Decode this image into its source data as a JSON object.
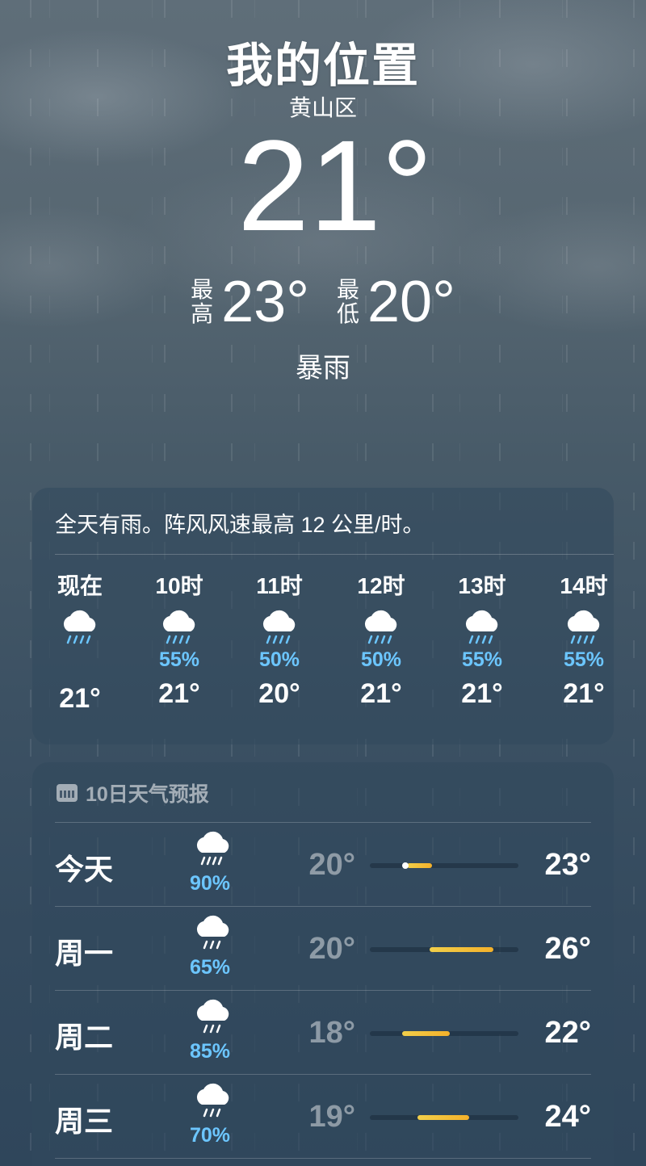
{
  "location": {
    "title": "我的位置",
    "district": "黄山区"
  },
  "current": {
    "temp": "21°",
    "high_label": [
      "最",
      "高"
    ],
    "high": "23°",
    "low_label": [
      "最",
      "低"
    ],
    "low": "20°",
    "condition": "暴雨"
  },
  "hourly": {
    "summary": "全天有雨。阵风风速最高 12 公里/时。",
    "items": [
      {
        "time": "现在",
        "icon": "cloud-rain-icon",
        "pop": "",
        "temp": "21°"
      },
      {
        "time": "10时",
        "icon": "cloud-rain-icon",
        "pop": "55%",
        "temp": "21°"
      },
      {
        "time": "11时",
        "icon": "cloud-rain-icon",
        "pop": "50%",
        "temp": "20°"
      },
      {
        "time": "12时",
        "icon": "cloud-rain-icon",
        "pop": "50%",
        "temp": "21°"
      },
      {
        "time": "13时",
        "icon": "cloud-rain-icon",
        "pop": "55%",
        "temp": "21°"
      },
      {
        "time": "14时",
        "icon": "cloud-rain-icon",
        "pop": "55%",
        "temp": "21°"
      }
    ]
  },
  "forecast": {
    "header": "10日天气预报",
    "header_icon": "calendar-icon",
    "days": [
      {
        "name": "今天",
        "icon": "cloud-heavy-rain-icon",
        "pop": "90%",
        "low": "20°",
        "high": "23°",
        "range_start": 0.25,
        "range_end": 0.42,
        "current_marker": 0.22
      },
      {
        "name": "周一",
        "icon": "cloud-rain-icon",
        "pop": "65%",
        "low": "20°",
        "high": "26°",
        "range_start": 0.4,
        "range_end": 0.83
      },
      {
        "name": "周二",
        "icon": "cloud-rain-icon",
        "pop": "85%",
        "low": "18°",
        "high": "22°",
        "range_start": 0.22,
        "range_end": 0.54
      },
      {
        "name": "周三",
        "icon": "cloud-rain-icon",
        "pop": "70%",
        "low": "19°",
        "high": "24°",
        "range_start": 0.32,
        "range_end": 0.67
      }
    ]
  },
  "colors": {
    "precip": "#6cc6ff",
    "range_bar": "#f4b12a"
  }
}
